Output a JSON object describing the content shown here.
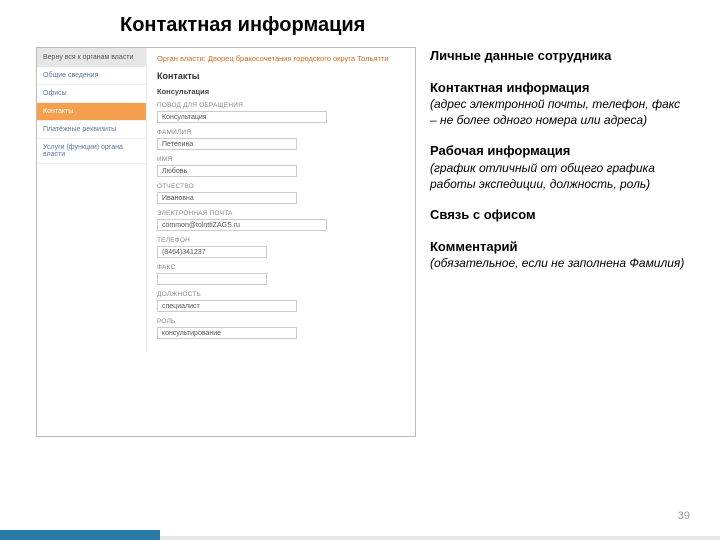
{
  "slide": {
    "title": "Контактная информация",
    "pagenum": "39"
  },
  "screenshot": {
    "nav_head": "Верну вся к органам власти",
    "nav": [
      "Общие сведения",
      "Офисы",
      "Контакты",
      "Платёжные реквизиты",
      "Услуги (функции) органа власти"
    ],
    "org_label": "Орган власти: Дворец бракосочетания городского округа Тольятти",
    "heading": "Контакты",
    "sub": "Консультация",
    "fields": {
      "f1_label": "ПОВОД ДЛЯ ОБРАЩЕНИЯ",
      "f1_val": "Консультация",
      "f2_label": "ФАМИЛИЯ",
      "f2_val": "Петелина",
      "f3_label": "ИМЯ",
      "f3_val": "Любовь",
      "f4_label": "ОТЧЕСТВО",
      "f4_val": "Ивановна",
      "f5_label": "ЭЛЕКТРОННАЯ ПОЧТА",
      "f5_val": "common@tolnttiZAGS.ru",
      "f6_label": "ТЕЛЕФОН",
      "f6_val": "(8464)341237",
      "f7_label": "ФАКС",
      "f7_val": "",
      "f8_label": "ДОЛЖНОСТЬ",
      "f8_val": "специалист",
      "f9_label": "РОЛЬ",
      "f9_val": "консультирование"
    }
  },
  "annot": {
    "b1": "Личные данные сотрудника",
    "b2_title": "Контактная информация",
    "b2_desc": "(адрес электронной почты, телефон, факс – не более одного номера или адреса)",
    "b3_title": "Рабочая информация",
    "b3_desc": "(график отличный от общего графика работы экспедиции, должность, роль)",
    "b4": "Связь с офисом",
    "b5_title": "Комментарий",
    "b5_desc": "(обязательное, если не заполнена Фамилия)"
  }
}
